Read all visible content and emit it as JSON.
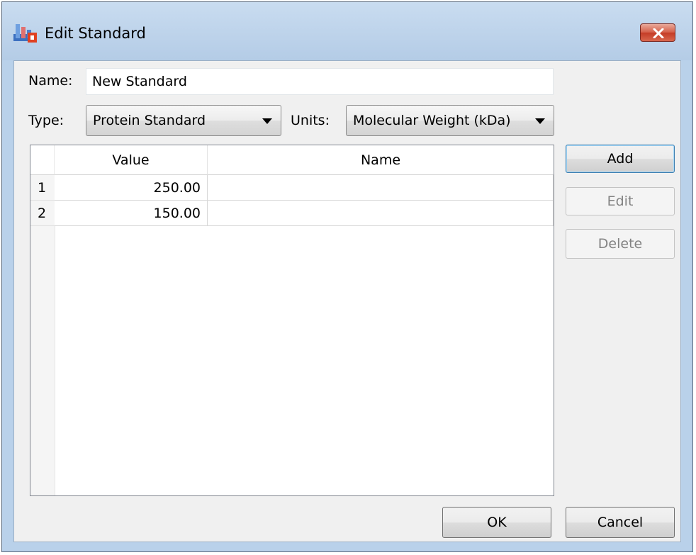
{
  "window": {
    "title": "Edit Standard",
    "app_icon": "standard-editor-icon",
    "close_icon": "close-icon",
    "close_color": "#c94a33"
  },
  "form": {
    "name_label": "Name:",
    "name_value": "New Standard",
    "type_label": "Type:",
    "type_value": "Protein Standard",
    "units_label": "Units:",
    "units_value": "Molecular Weight (kDa)"
  },
  "table": {
    "columns": [
      "Value",
      "Name"
    ],
    "rows": [
      {
        "index": "1",
        "value": "250.00",
        "name": ""
      },
      {
        "index": "2",
        "value": "150.00",
        "name": ""
      }
    ]
  },
  "side_buttons": {
    "add": "Add",
    "edit": "Edit",
    "delete": "Delete"
  },
  "footer": {
    "ok": "OK",
    "cancel": "Cancel"
  }
}
